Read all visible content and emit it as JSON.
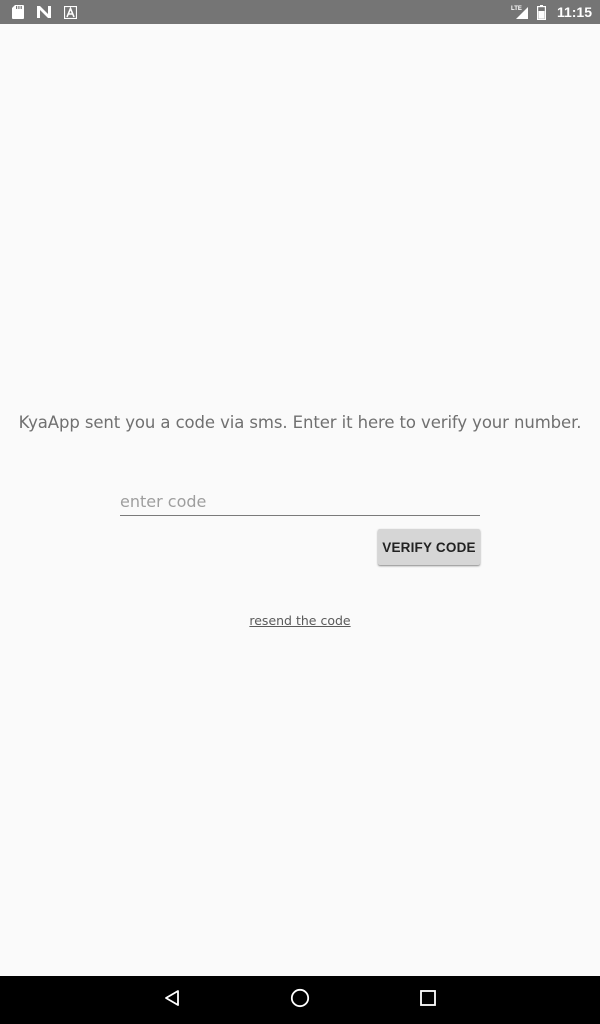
{
  "status_bar": {
    "left_icons": [
      "sd-card-icon",
      "n-notification-icon",
      "a-notification-icon"
    ],
    "network_label": "LTE",
    "time": "11:15"
  },
  "main": {
    "message": "KyaApp sent you a code via sms. Enter it here to verify your number.",
    "code_input": {
      "placeholder": "enter code",
      "value": ""
    },
    "verify_button_label": "VERIFY CODE",
    "resend_link_label": "resend the code"
  },
  "nav_bar": {
    "buttons": [
      "back-icon",
      "home-icon",
      "recents-icon"
    ]
  },
  "colors": {
    "status_bar": "#757575",
    "background": "#fafafa",
    "button": "#d6d6d6",
    "nav_bar": "#000000"
  }
}
